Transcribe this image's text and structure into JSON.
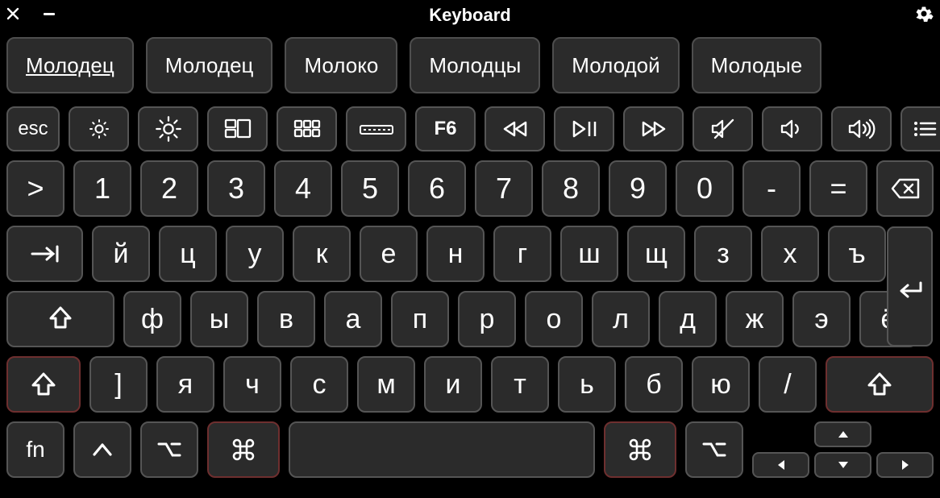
{
  "title": "Keyboard",
  "suggestions": [
    "Молодец",
    "Молодец",
    "Молоко",
    "Молодцы",
    "Молодой",
    "Молодые"
  ],
  "fn_row": {
    "esc": "esc",
    "f6": "F6"
  },
  "num_row": [
    ">",
    "1",
    "2",
    "3",
    "4",
    "5",
    "6",
    "7",
    "8",
    "9",
    "0",
    "-",
    "="
  ],
  "row_q": [
    "й",
    "ц",
    "у",
    "к",
    "е",
    "н",
    "г",
    "ш",
    "щ",
    "з",
    "х",
    "ъ"
  ],
  "row_a": [
    "ф",
    "ы",
    "в",
    "а",
    "п",
    "р",
    "о",
    "л",
    "д",
    "ж",
    "э",
    "ё"
  ],
  "row_z": [
    "]",
    "я",
    "ч",
    "с",
    "м",
    "и",
    "т",
    "ь",
    "б",
    "ю",
    "/"
  ],
  "bottom": {
    "fn": "fn"
  }
}
